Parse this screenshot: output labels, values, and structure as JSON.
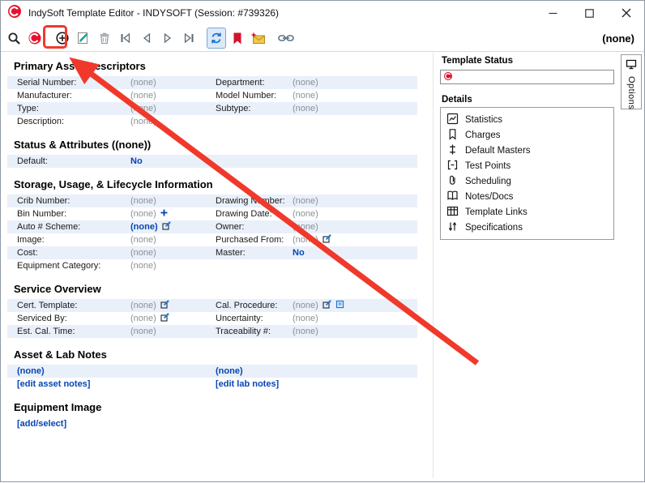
{
  "window": {
    "title": "IndySoft Template Editor - INDYSOFT (Session: #739326)"
  },
  "toolbar": {
    "record_indicator": "(none)"
  },
  "main": {
    "primary": {
      "title": "Primary Asset Descriptors",
      "rows": [
        {
          "l1": "Serial Number:",
          "v1": "(none)",
          "l2": "Department:",
          "v2": "(none)"
        },
        {
          "l1": "Manufacturer:",
          "v1": "(none)",
          "l2": "Model Number:",
          "v2": "(none)"
        },
        {
          "l1": "Type:",
          "v1": "(none)",
          "l2": "Subtype:",
          "v2": "(none)"
        },
        {
          "l1": "Description:",
          "v1": "(none)"
        }
      ]
    },
    "status": {
      "title": "Status & Attributes ((none))",
      "default_label": "Default:",
      "default_value": "No"
    },
    "storage": {
      "title": "Storage, Usage, & Lifecycle Information",
      "rows": [
        {
          "l1": "Crib Number:",
          "v1": "(none)",
          "l2": "Drawing Number:",
          "v2": "(none)"
        },
        {
          "l1": "Bin Number:",
          "v1": "(none)",
          "l2": "Drawing Date:",
          "v2": "(none)"
        },
        {
          "l1": "Auto # Scheme:",
          "v1": "(none)",
          "l2": "Owner:",
          "v2": "(none)"
        },
        {
          "l1": "Image:",
          "v1": "(none)",
          "l2": "Purchased From:",
          "v2": "(none)"
        },
        {
          "l1": "Cost:",
          "v1": "(none)",
          "l2": "Master:",
          "v2": "No"
        },
        {
          "l1": "Equipment Category:",
          "v1": "(none)"
        }
      ]
    },
    "service": {
      "title": "Service Overview",
      "rows": [
        {
          "l1": "Cert. Template:",
          "v1": "(none)",
          "l2": "Cal. Procedure:",
          "v2": "(none)"
        },
        {
          "l1": "Serviced By:",
          "v1": "(none)",
          "l2": "Uncertainty:",
          "v2": "(none)"
        },
        {
          "l1": "Est. Cal. Time:",
          "v1": "(none)",
          "l2": "Traceability #:",
          "v2": "(none)"
        }
      ]
    },
    "notes": {
      "title": "Asset & Lab Notes",
      "asset_value": "(none)",
      "lab_value": "(none)",
      "edit_asset_link": "[edit asset notes]",
      "edit_lab_link": "[edit lab notes]"
    },
    "image": {
      "title": "Equipment Image",
      "add_select_link": "[add/select]"
    }
  },
  "sidebar": {
    "template_status_label": "Template Status",
    "details_label": "Details",
    "items": [
      "Statistics",
      "Charges",
      "Default Masters",
      "Test Points",
      "Scheduling",
      "Notes/Docs",
      "Template Links",
      "Specifications"
    ],
    "options_tab_label": "Options"
  },
  "colors": {
    "annotation_red": "#f0392b",
    "link_blue": "#0645b4",
    "row_stripe": "#e9f0f9",
    "brand_red": "#e8112d"
  }
}
